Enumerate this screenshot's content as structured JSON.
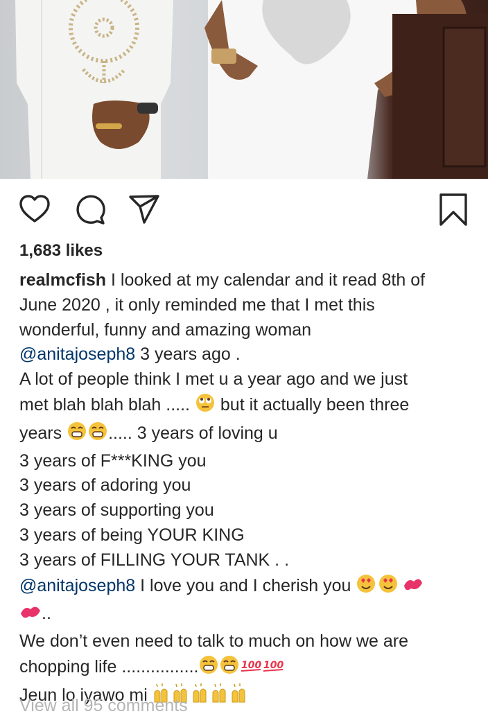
{
  "post": {
    "likes_label": "1,683 likes",
    "caption": {
      "username": "realmcfish",
      "line1": " I looked at my calendar and it read 8th of",
      "line2": "June 2020 , it only reminded me that I met this",
      "line3": "wonderful, funny and amazing woman",
      "mention1": "@anitajoseph8",
      "line4_rest": " 3 years ago .",
      "line5": "A lot of people think I met u a year ago and we just",
      "line6a": "met blah blah blah ..... ",
      "line6b": " but it actually been three",
      "line7a": "years ",
      "line7b": "..... 3 years of loving u",
      "line8": "3 years of F***KING you",
      "line9": "3 years of adoring you",
      "line10": "3 years of supporting you",
      "line11": "3 years of being YOUR KING",
      "line12": "3 years of FILLING YOUR TANK . .",
      "mention2": "@anitajoseph8",
      "line13_rest": " I love you and I cherish you ",
      "line14_rest": "..",
      "line15": "We don’t even need to talk to much on how we are",
      "line16": "chopping life ................",
      "line17": "Jeun lo iyawo mi "
    },
    "view_all_label": "View all 95 comments"
  },
  "icons": {
    "like": "heart-icon",
    "comment": "comment-icon",
    "share": "paper-plane-icon",
    "save": "bookmark-icon"
  },
  "colors": {
    "text": "#262626",
    "mention": "#003569",
    "muted": "#b5b5b5"
  }
}
